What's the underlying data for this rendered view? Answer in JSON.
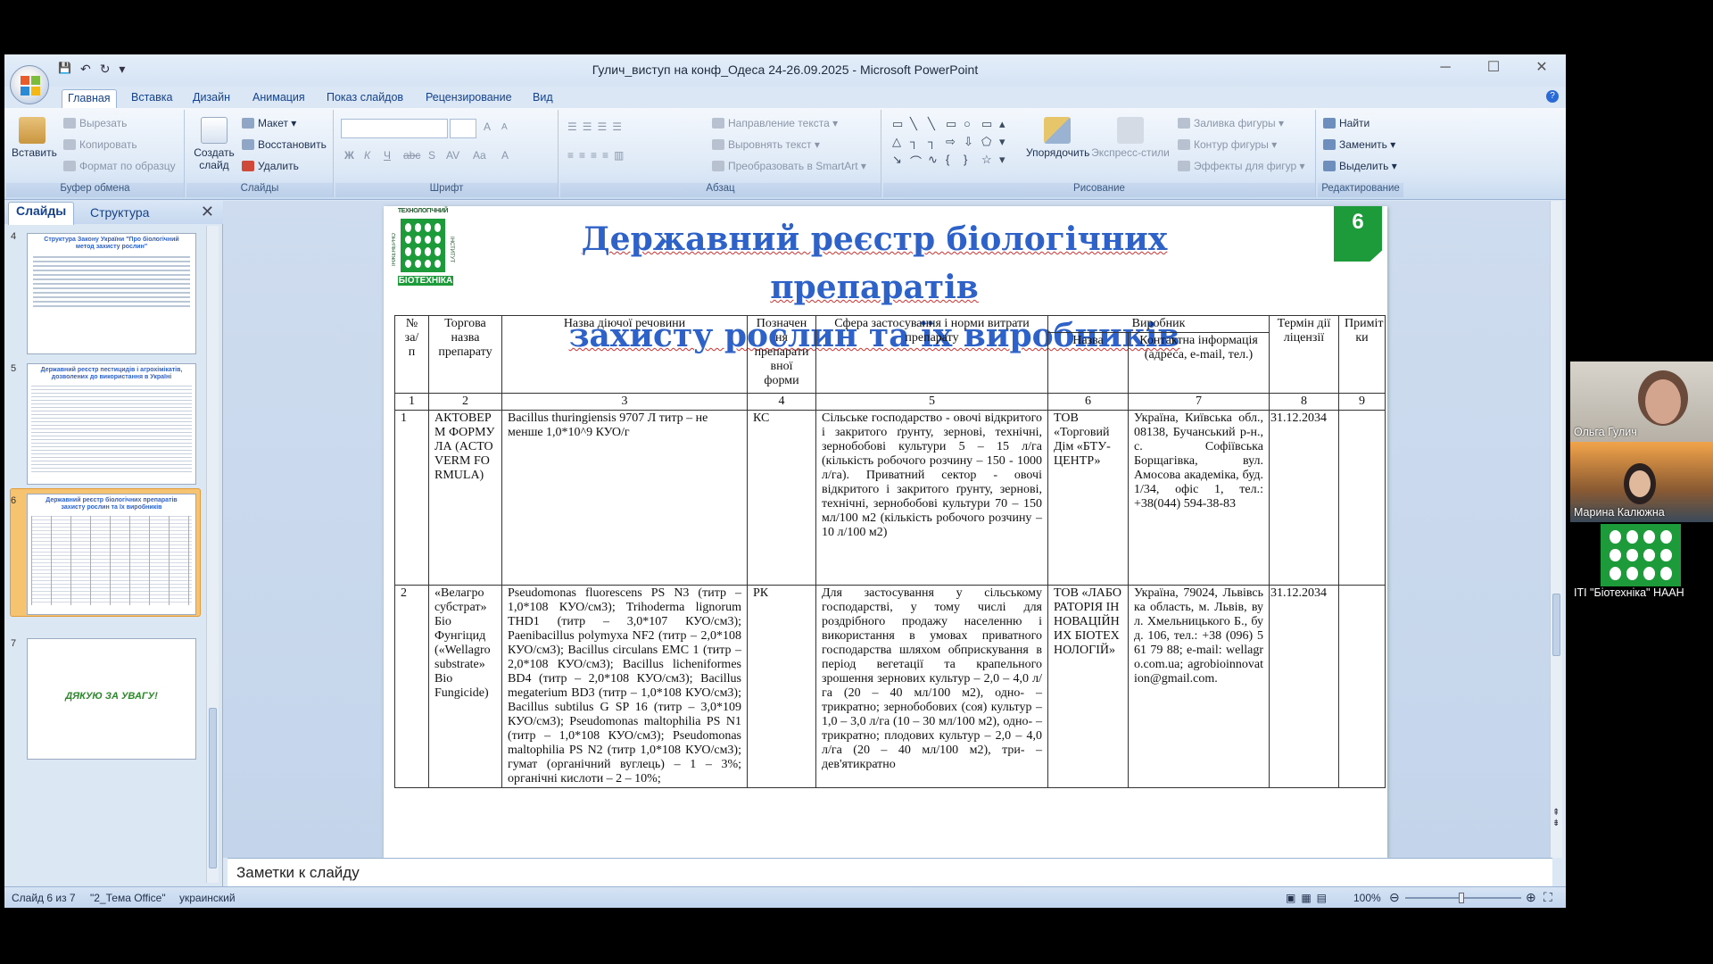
{
  "window": {
    "title": "Гулич_виступ на конф_Одеса 24-26.09.2025 - Microsoft PowerPoint",
    "controls": {
      "minimize": "─",
      "maximize": "☐",
      "close": "✕"
    },
    "qat": {
      "save": "💾",
      "undo": "↶",
      "redo": "↻",
      "more": "▾"
    }
  },
  "tabs": [
    "Главная",
    "Вставка",
    "Дизайн",
    "Анимация",
    "Показ слайдов",
    "Рецензирование",
    "Вид"
  ],
  "ribbon": {
    "clipboard": {
      "label": "Буфер обмена",
      "paste": "Вставить",
      "cut": "Вырезать",
      "copy": "Копировать",
      "format": "Формат по образцу"
    },
    "slides": {
      "label": "Слайды",
      "new_slide_1": "Создать",
      "new_slide_2": "слайд",
      "layout": "Макет",
      "reset": "Восстановить",
      "delete": "Удалить"
    },
    "font": {
      "label": "Шрифт",
      "bold": "Ж",
      "italic": "К",
      "underline": "Ч",
      "strike": "abc",
      "shadow": "S",
      "spacing": "AV",
      "case": "Aa",
      "color": "A",
      "grow": "A",
      "shrink": "A"
    },
    "paragraph": {
      "label": "Абзац",
      "text_dir": "Направление текста",
      "align_text": "Выровнять текст",
      "smartart": "Преобразовать в SmartArt"
    },
    "drawing": {
      "label": "Рисование",
      "arrange": "Упорядочить",
      "quick_styles": "Экспресс-стили",
      "fill": "Заливка фигуры",
      "outline": "Контур фигуры",
      "effects": "Эффекты для фигур"
    },
    "editing": {
      "label": "Редактирование",
      "find": "Найти",
      "replace": "Заменить",
      "select": "Выделить"
    }
  },
  "left_pane": {
    "tabs": [
      "Слайды",
      "Структура"
    ],
    "close": "✕",
    "thumbnails": [
      {
        "num": "4",
        "title": "Структура Закону України \"Про біологічний метод захисту рослин\""
      },
      {
        "num": "5",
        "title": "Державний реєстр пестицидів і агрохімікатів, дозволених до використання в Україні"
      },
      {
        "num": "6",
        "title": "Державний реєстр біологічних препаратів захисту рослин та їх виробників"
      },
      {
        "num": "7",
        "title": "ДЯКУЮ ЗА УВАГУ!"
      }
    ]
  },
  "slide": {
    "title_line1": "Державний реєстр біологічних препаратів",
    "title_line2": "захисту рослин та їх виробників",
    "number": "6",
    "table": {
      "headers": {
        "num": "№ за/ п",
        "trade": "Торгова назва препарату",
        "substance": "Назва діючої речовини",
        "form": "Позначен ня препарати вної форми",
        "scope": "Сфера застосування і норми витрати препарату",
        "producer": "Виробник",
        "producer_name": "Назва",
        "producer_contact": "Контактна інформація (адреса, e-mail, тел.)",
        "term": "Термін дії ліцензії",
        "notes": "Приміт ки"
      },
      "col_numbers": [
        "1",
        "2",
        "3",
        "4",
        "5",
        "6",
        "7",
        "8",
        "9"
      ],
      "rows": [
        {
          "num": "1",
          "trade": "АКТОВЕРМ ФОРМУЛА (ACTOVERM FORMULA)",
          "substance": "Bacillus thuringiensis 9707 Л титр – не менше 1,0*10^9 КУО/г",
          "form": "КС",
          "scope": "Сільське господарство - овочі відкритого і закритого ґрунту, зернові, технічні, зернобобові культури 5 – 15 л/га (кількість робочого розчину – 150 - 1000 л/га). Приватний сектор - овочі відкритого і закритого ґрунту, зернові, технічні, зернобобові культури 70 – 150 мл/100 м2 (кількість робочого розчину – 10 л/100 м2)",
          "producer_name": "ТОВ «Торговий Дім «БТУ-ЦЕНТР»",
          "producer_contact": "Україна, Київська обл., 08138, Бучанський р-н., с. Софіївська Борщагівка, вул. Амосова академіка, буд. 1/34, офіс 1, тел.: +38(044) 594-38-83",
          "term": "31.12.2034",
          "notes": ""
        },
        {
          "num": "2",
          "trade": "«Велагро субстрат» Біо Фунгіцид («Wellagro substrate» Bio Fungicide)",
          "substance": "Pseudomonas fluorescens PS N3 (титр – 1,0*108 КУО/см3); Trihoderma lignorum THD1 (титр – 3,0*107 КУО/см3); Paenibacillus polymyxa NF2 (титр – 2,0*108 КУО/см3); Bacillus circulans EMC 1 (титр – 2,0*108 КУО/см3); Bacillus licheniformes BD4 (титр – 2,0*108 КУО/см3); Bacillus megaterium BD3 (титр – 1,0*108 КУО/см3); Bacillus subtilus G SP 16 (титр – 3,0*109 КУО/см3); Pseudomonas maltophilia PS N1 (титр – 1,0*108 КУО/см3); Pseudomonas maltophilia PS N2 (титр 1,0*108 КУО/см3); гумат (органічний вуглець) – 1 – 3%; органічні кислоти – 2 – 10%;",
          "form": "РК",
          "scope": "Для застосування у сільському господарстві, у тому числі для роздрібного продажу населенню і використання в умовах приватного господарства шляхом обприскування в період вегетації та крапельного зрошення зернових культур – 2,0 – 4,0 л/га (20 – 40 мл/100 м2), одно- – трикратно; зернобобових (соя) культур – 1,0 – 3,0 л/га (10 – 30 мл/100 м2), одно- – трикратно; плодових культур – 2,0 – 4,0 л/га (20 – 40 мл/100 м2), три- – дев'ятикратно",
          "producer_name": "ТОВ «ЛАБОРАТОРІЯ ІННОВАЦІЙНИХ БІОТЕХНОЛОГІЙ»",
          "producer_contact": "Україна, 79024, Львівська область, м. Львів, вул. Хмельницького Б., буд. 106, тел.: +38 (096) 561 79 88; e-mail: wellagro.com.ua; agrobioinnovation@gmail.com.",
          "term": "31.12.2034",
          "notes": ""
        }
      ]
    },
    "logo_text_top": "ТЕХНОЛОГІЧНИЙ",
    "logo_text_bottom": "БІОТЕХНІКА",
    "logo_text_left": "ІНЖЕНЕРНО",
    "logo_text_right": "ІНСТИТУТ"
  },
  "notes_placeholder": "Заметки к слайду",
  "status": {
    "slide": "Слайд 6 из 7",
    "theme": "\"2_Тема Office\"",
    "lang": "украинский",
    "zoom": "100%"
  },
  "participants": [
    {
      "name": "Ольга Гулич"
    },
    {
      "name": "Марина Калюжна"
    },
    {
      "name": "ITI \"Біотехніка\" НААН"
    }
  ],
  "colors": {
    "title_blue": "#2e62c8",
    "logo_green": "#1d9a3a",
    "accent_ribbon": "#15428b"
  }
}
